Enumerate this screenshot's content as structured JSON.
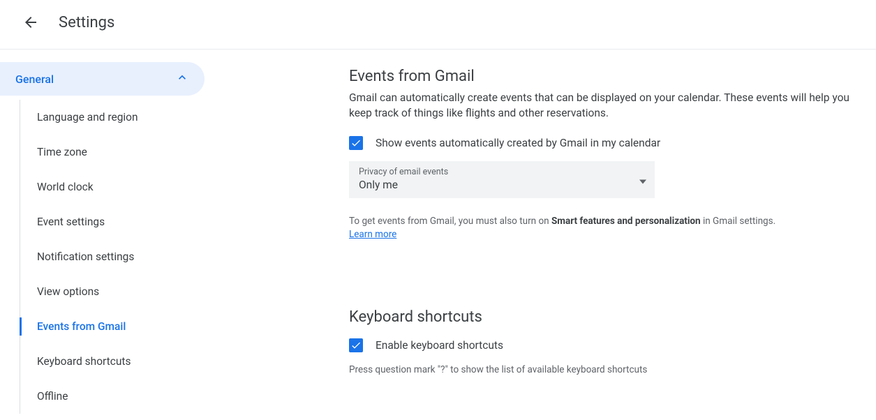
{
  "header": {
    "title": "Settings"
  },
  "sidebar": {
    "category": "General",
    "items": [
      "Language and region",
      "Time zone",
      "World clock",
      "Event settings",
      "Notification settings",
      "View options",
      "Events from Gmail",
      "Keyboard shortcuts",
      "Offline"
    ],
    "active_index": 6
  },
  "events_section": {
    "title": "Events from Gmail",
    "description": "Gmail can automatically create events that can be displayed on your calendar. These events will help you keep track of things like flights and other reservations.",
    "checkbox_label": "Show events automatically created by Gmail in my calendar",
    "select_label": "Privacy of email events",
    "select_value": "Only me",
    "note_prefix": "To get events from Gmail, you must also turn on ",
    "note_bold": "Smart features and personalization",
    "note_suffix": " in Gmail settings. ",
    "learn_more": "Learn more"
  },
  "keyboard_section": {
    "title": "Keyboard shortcuts",
    "checkbox_label": "Enable keyboard shortcuts",
    "hint": "Press question mark \"?\" to show the list of available keyboard shortcuts"
  }
}
